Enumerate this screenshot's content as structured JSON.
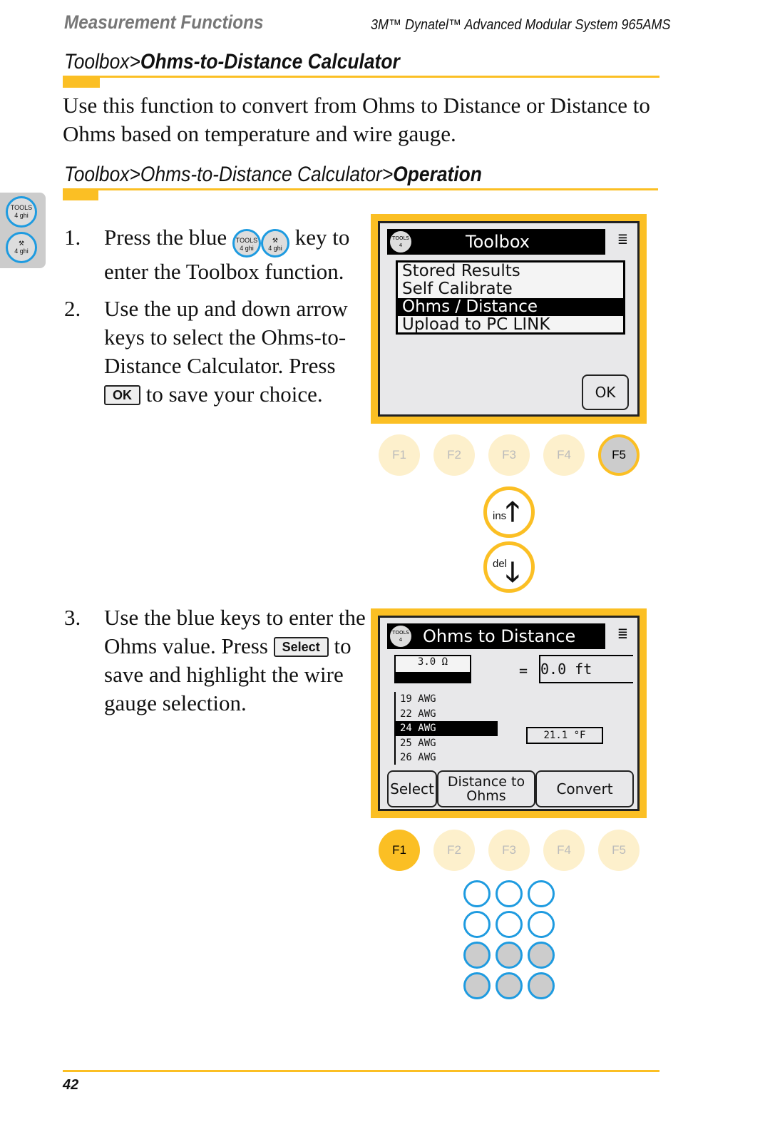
{
  "header": {
    "section": "Measurement Functions",
    "product": "3M™ Dynatel™ Advanced Modular System 965AMS"
  },
  "title": {
    "prefix": "Toolbox>",
    "bold": "Ohms-to-Distance Calculator"
  },
  "intro": "Use this function to convert from Ohms to Distance or Distance to Ohms based on temperature and wire gauge.",
  "subtitle": {
    "prefix": "Toolbox>Ohms-to-Distance Calculator>",
    "bold": "Operation"
  },
  "side_tab": {
    "key1": "TOOLS",
    "key1_sub": "4 ghi",
    "key2_sub": "4 ghi"
  },
  "steps": [
    {
      "num": "1.",
      "a": "Press the blue",
      "b": "key to enter the Toolbox function.",
      "key1": "TOOLS",
      "key_sub": "4 ghi"
    },
    {
      "num": "2.",
      "a": "Use the up and down arrow keys to select the Ohms-to-Distance Calculator. Press",
      "key": "OK",
      "b": "to save your choice."
    },
    {
      "num": "3.",
      "a": "Use the blue keys to enter the Ohms value. Press",
      "key": "Select",
      "b": "to save and highlight the wire gauge selection."
    }
  ],
  "screen1": {
    "icon": "TOOLS 4",
    "title": "Toolbox",
    "items": [
      "Stored Results",
      "Self Calibrate",
      "Ohms / Distance",
      "Upload to PC LINK"
    ],
    "selected": 2,
    "ok": "OK"
  },
  "fkeys1": {
    "labels": [
      "F1",
      "F2",
      "F3",
      "F4",
      "F5"
    ],
    "active": "F5"
  },
  "arrows": {
    "up": "ins",
    "down": "del"
  },
  "screen2": {
    "icon": "TOOLS 4",
    "title": "Ohms to Distance",
    "ohms": "3.0 Ω",
    "equals": "=",
    "distance": "0.0 ft",
    "gauges": [
      "19 AWG",
      "22 AWG",
      "24 AWG",
      "25 AWG",
      "26 AWG"
    ],
    "selected": 2,
    "temp": "21.1 °F",
    "buttons": [
      "Select",
      "Distance to Ohms",
      "Convert"
    ]
  },
  "fkeys2": {
    "labels": [
      "F1",
      "F2",
      "F3",
      "F4",
      "F5"
    ],
    "active": "F1"
  },
  "colors": {
    "accent": "#fbbf24",
    "blue": "#1e9be0"
  },
  "footer": {
    "page": "42"
  }
}
